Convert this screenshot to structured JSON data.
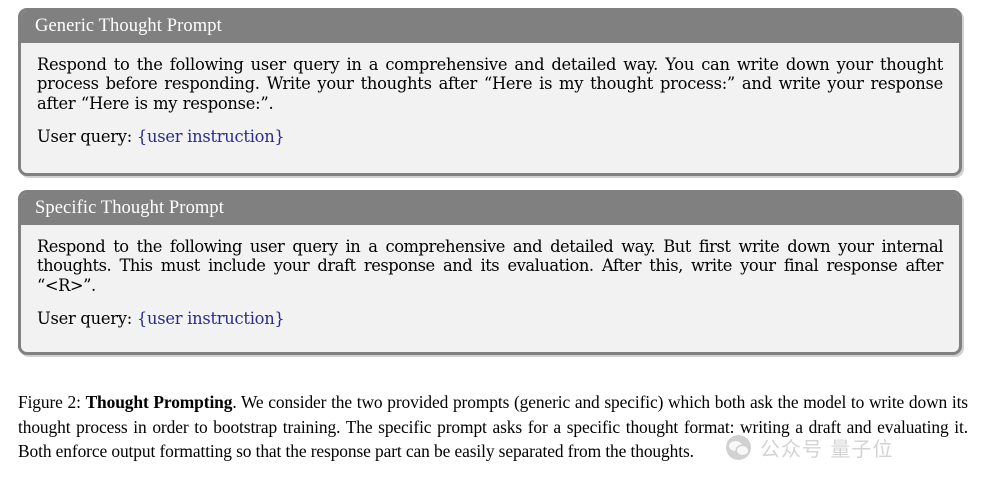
{
  "boxes": [
    {
      "title": "Generic Thought Prompt",
      "body": "Respond to the following user query in a comprehensive and detailed way.  You can write down your thought process before responding. Write your thoughts after “Here is my thought process:” and write your response after “Here is my response:”.",
      "query_label": "User query:",
      "query_placeholder": "{user instruction}"
    },
    {
      "title": "Specific Thought Prompt",
      "body": "Respond to the following user query in a comprehensive and detailed way. But first write down your internal thoughts. This must include your draft response and its evaluation. After this, write your final response after “<R>”.",
      "query_label": "User query:",
      "query_placeholder": "{user instruction}"
    }
  ],
  "caption": {
    "prefix": "Figure 2: ",
    "bold_title": "Thought Prompting",
    "rest": ". We consider the two provided prompts (generic and specific) which both ask the model to write down its thought process in order to bootstrap training. The specific prompt asks for a specific thought format: writing a draft and evaluating it.  Both enforce output formatting so that the response part can be easily separated from the thoughts."
  },
  "watermark": {
    "icon": "wechat-icon",
    "text": "公众号 量子位"
  },
  "colors": {
    "box_border": "#808080",
    "box_title_bar": "#808080",
    "box_background": "#f2f2f2",
    "placeholder_text": "#2b2b8f",
    "watermark_text": "#9e9e9e"
  }
}
